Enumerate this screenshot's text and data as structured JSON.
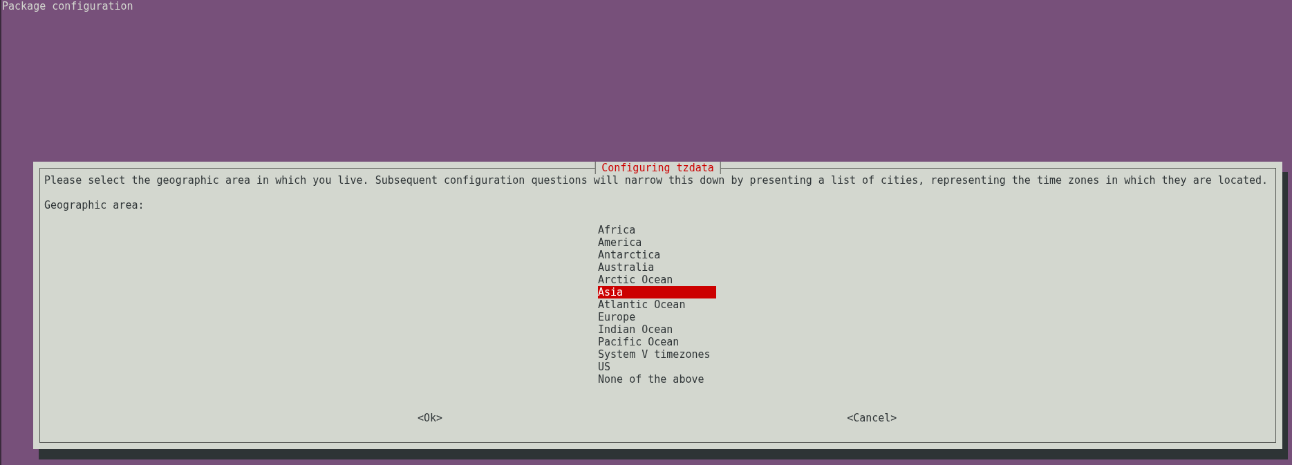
{
  "screen_title": "Package configuration",
  "dialog": {
    "title": "Configuring tzdata",
    "description": "Please select the geographic area in which you live. Subsequent configuration questions will narrow this down by presenting a list of cities, representing the time zones in which they are located.",
    "prompt": "Geographic area:",
    "options": [
      {
        "label": "Africa",
        "selected": false
      },
      {
        "label": "America",
        "selected": false
      },
      {
        "label": "Antarctica",
        "selected": false
      },
      {
        "label": "Australia",
        "selected": false
      },
      {
        "label": "Arctic Ocean",
        "selected": false
      },
      {
        "label": "Asia",
        "selected": true
      },
      {
        "label": "Atlantic Ocean",
        "selected": false
      },
      {
        "label": "Europe",
        "selected": false
      },
      {
        "label": "Indian Ocean",
        "selected": false
      },
      {
        "label": "Pacific Ocean",
        "selected": false
      },
      {
        "label": "System V timezones",
        "selected": false
      },
      {
        "label": "US",
        "selected": false
      },
      {
        "label": "None of the above",
        "selected": false
      }
    ],
    "buttons": [
      "<Ok>",
      "<Cancel>"
    ]
  }
}
